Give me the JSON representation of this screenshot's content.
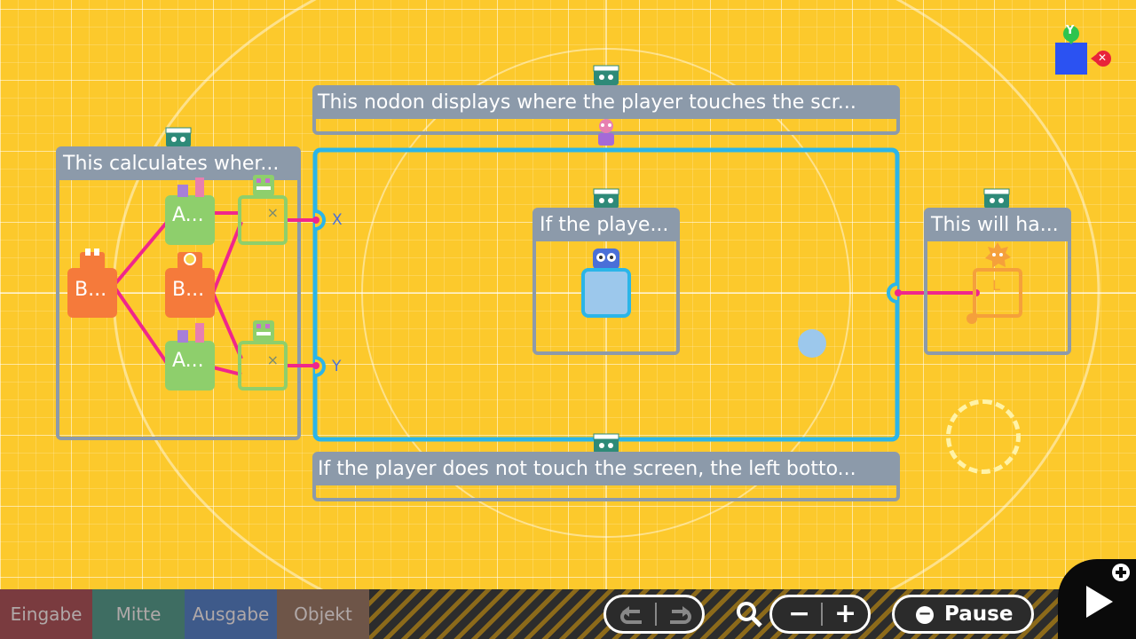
{
  "comments": {
    "top": "This nodon displays where the player touches the scr...",
    "bottom": "If the player does not touch the screen, the left botto...",
    "left_group": "This calculates wher...",
    "center_group": "If the playe...",
    "right_group": "This will ha..."
  },
  "nodes": {
    "button_b1": "B...",
    "button_b2": "B...",
    "map_a1": "A...",
    "map_a2": "A...",
    "output_l": "L"
  },
  "ports": {
    "x": "X",
    "y": "Y"
  },
  "axis_indicator": {
    "y_label": "Y",
    "close_label": "✕"
  },
  "tabs": [
    {
      "label": "Eingabe",
      "color": "#7a3b3f"
    },
    {
      "label": "Mitte",
      "color": "#3e6d62"
    },
    {
      "label": "Ausgabe",
      "color": "#3e5a8a"
    },
    {
      "label": "Objekt",
      "color": "#6e5548"
    }
  ],
  "controls": {
    "pause_label": "Pause",
    "zoom_out": "−",
    "zoom_in": "+"
  },
  "colors": {
    "background": "#fcc92c",
    "wire": "#f0268c",
    "frame_blue": "#2bb5e8",
    "comment_gray": "#8c9aaa"
  }
}
